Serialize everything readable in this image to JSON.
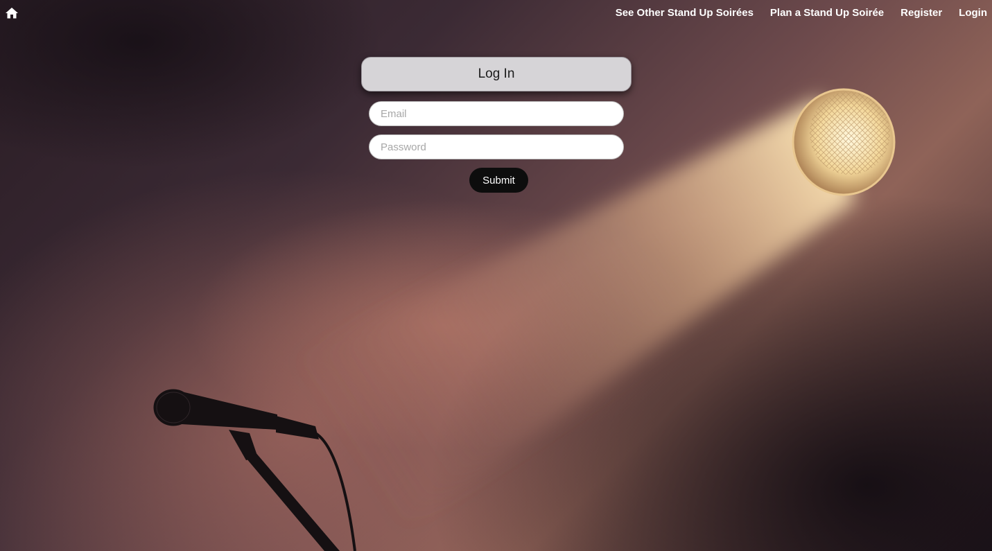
{
  "nav": {
    "home_icon": "home-icon",
    "links": [
      {
        "label": "See Other Stand Up Soirées"
      },
      {
        "label": "Plan a Stand Up Soirée"
      },
      {
        "label": "Register"
      },
      {
        "label": "Login"
      }
    ]
  },
  "login": {
    "title": "Log In",
    "email_placeholder": "Email",
    "password_placeholder": "Password",
    "submit_label": "Submit"
  },
  "colors": {
    "nav_text": "#ffffff",
    "title_bg": "#d6d4d7",
    "submit_bg": "#0d0d0d"
  },
  "background": {
    "icons": [
      "spotlight-icon",
      "microphone-icon"
    ]
  }
}
